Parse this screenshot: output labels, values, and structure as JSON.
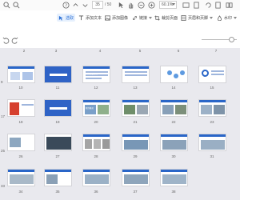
{
  "toolbar": {
    "page_current": "35",
    "page_total": "/ 50",
    "zoom": "60.1%"
  },
  "tools": [
    {
      "label": "选取",
      "active": true
    },
    {
      "label": "添加文本",
      "active": false
    },
    {
      "label": "添加图像",
      "active": false
    },
    {
      "label": "链接",
      "active": false
    },
    {
      "label": "裁剪页面",
      "active": false
    },
    {
      "label": "页眉和页脚",
      "active": false
    },
    {
      "label": "水印",
      "active": false
    }
  ],
  "grid": {
    "row_labels": [
      [
        "2",
        "3",
        "4",
        "5",
        "6",
        "7"
      ],
      [
        "10",
        "11",
        "12",
        "13",
        "14",
        "15"
      ],
      [
        "18",
        "19",
        "20",
        "21",
        "22",
        "23"
      ],
      [
        "26",
        "27",
        "28",
        "29",
        "30",
        "31"
      ],
      [
        "34",
        "35",
        "36",
        "37",
        "38"
      ]
    ],
    "left_labels": [
      "9",
      "17",
      "25",
      "33"
    ],
    "slide_title_12": "1. 工程建设概况",
    "slide_title_19": "5. 项目概况",
    "colors": {
      "accent": "#2a66c8",
      "selected_fill": "#e6f0fd",
      "background": "#e9e9ee"
    }
  }
}
